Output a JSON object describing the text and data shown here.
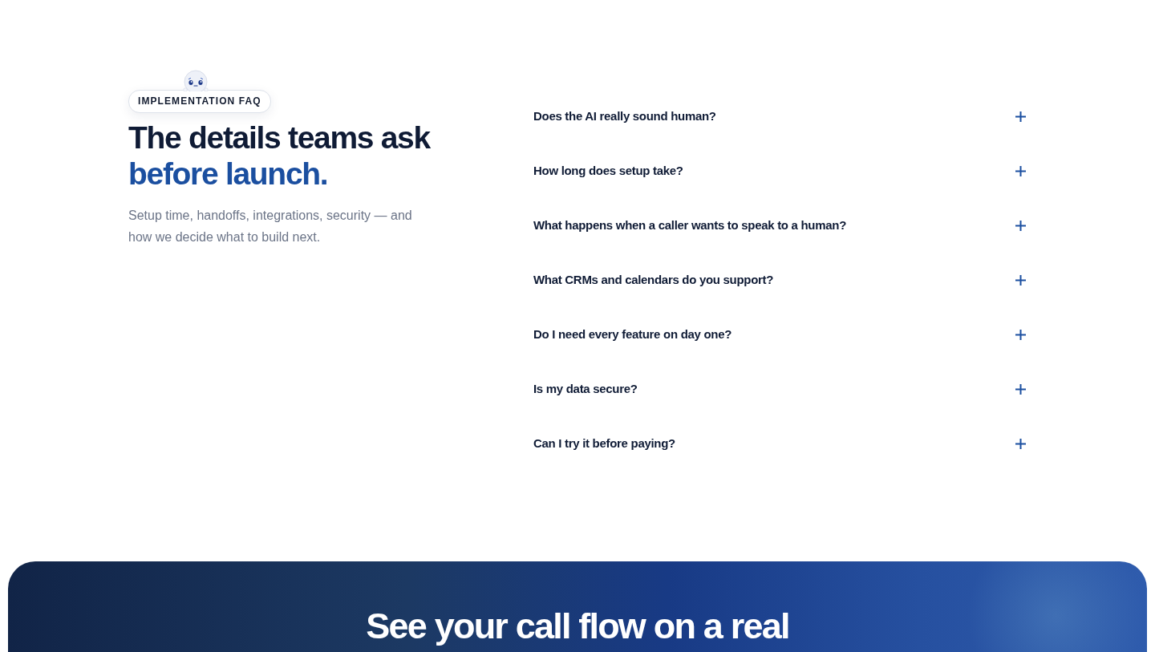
{
  "intro": {
    "badge": "IMPLEMENTATION FAQ",
    "heading": {
      "text": "The details teams ask",
      "accent": "before launch."
    },
    "subtitle": "Setup time, handoffs, integrations, security — and how we decide what to build next."
  },
  "faq": [
    {
      "question": "Does the AI really sound human?",
      "expanded": false
    },
    {
      "question": "How long does setup take?",
      "expanded": false
    },
    {
      "question": "What happens when a caller wants to speak to a human?",
      "expanded": false
    },
    {
      "question": "What CRMs and calendars do you support?",
      "expanded": false
    },
    {
      "question": "Do I need every feature on day one?",
      "expanded": false
    },
    {
      "question": "Is my data secure?",
      "expanded": false
    },
    {
      "question": "Can I try it before paying?",
      "expanded": false
    }
  ],
  "cta": {
    "title": "See your call flow on a real"
  }
}
